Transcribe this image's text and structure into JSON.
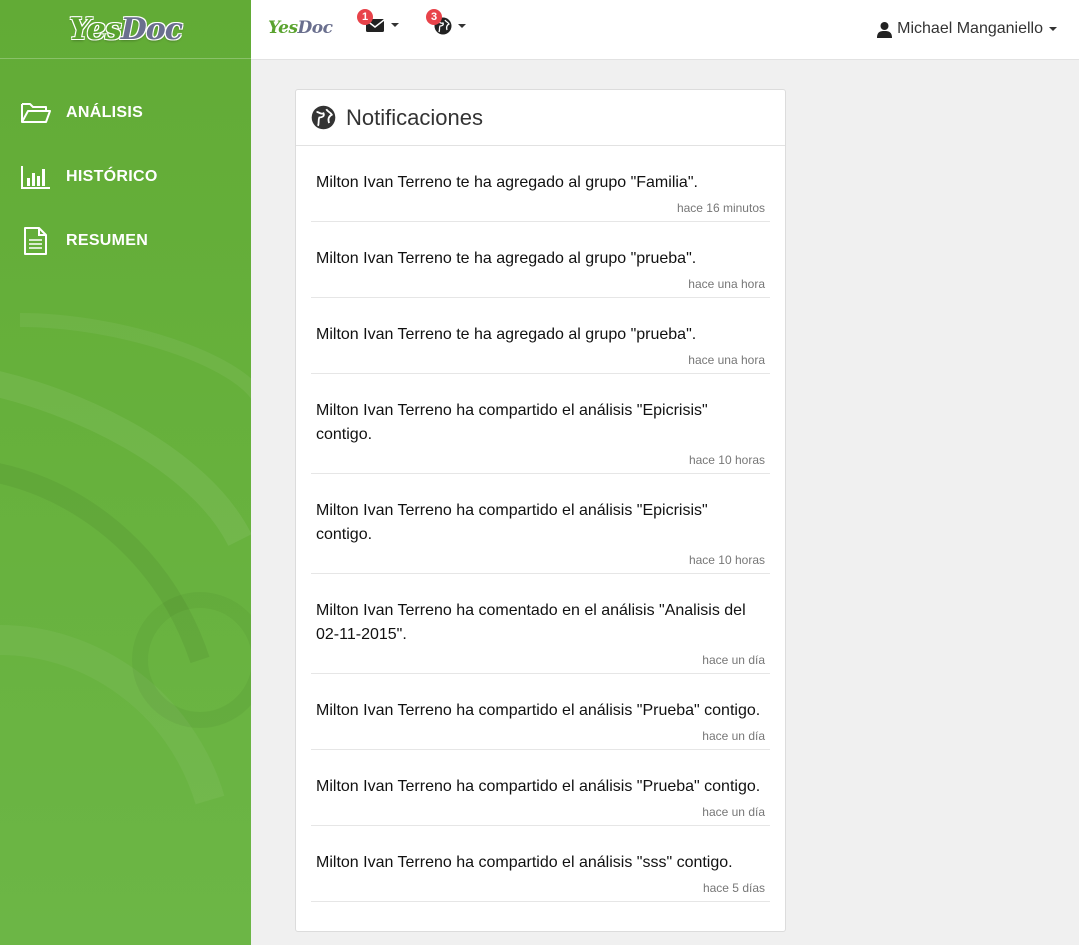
{
  "brand": {
    "yes": "Yes",
    "doc": "Doc"
  },
  "sidebar": {
    "items": [
      {
        "label": "ANÁLISIS",
        "icon": "folder-open-icon"
      },
      {
        "label": "HISTÓRICO",
        "icon": "bar-chart-icon"
      },
      {
        "label": "RESUMEN",
        "icon": "document-icon"
      }
    ]
  },
  "topbar": {
    "messages": {
      "icon": "envelope-icon",
      "badge": "1"
    },
    "notifications": {
      "icon": "globe-icon",
      "badge": "3"
    },
    "user": {
      "icon": "user-icon",
      "name": "Michael Manganiello"
    }
  },
  "panel": {
    "title": "Notificaciones",
    "icon": "globe-icon",
    "items": [
      {
        "text": "Milton Ivan Terreno te ha agregado al grupo \"Familia\".",
        "time": "hace 16 minutos"
      },
      {
        "text": "Milton Ivan Terreno te ha agregado al grupo \"prueba\".",
        "time": "hace una hora"
      },
      {
        "text": "Milton Ivan Terreno te ha agregado al grupo \"prueba\".",
        "time": "hace una hora"
      },
      {
        "text": "Milton Ivan Terreno ha compartido el análisis \"Epicrisis\" contigo.",
        "time": "hace 10 horas"
      },
      {
        "text": "Milton Ivan Terreno ha compartido el análisis \"Epicrisis\" contigo.",
        "time": "hace 10 horas"
      },
      {
        "text": "Milton Ivan Terreno ha comentado en el análisis \"Analisis del 02-11-2015\".",
        "time": "hace un día"
      },
      {
        "text": "Milton Ivan Terreno ha compartido el análisis \"Prueba\" contigo.",
        "time": "hace un día"
      },
      {
        "text": "Milton Ivan Terreno ha compartido el análisis \"Prueba\" contigo.",
        "time": "hace un día"
      },
      {
        "text": "Milton Ivan Terreno ha compartido el análisis \"sss\" contigo.",
        "time": "hace 5 días"
      }
    ]
  },
  "colors": {
    "sidebar": "#66b03b",
    "brand_green": "#5aa32f",
    "brand_gray": "#6a6f8e",
    "badge": "#e8434a"
  }
}
